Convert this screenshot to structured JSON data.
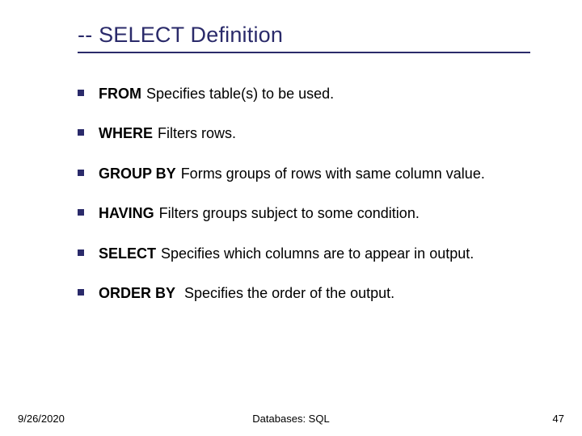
{
  "title": "-- SELECT Definition",
  "items": [
    {
      "keyword": "FROM",
      "desc": "Specifies table(s) to be used."
    },
    {
      "keyword": "WHERE",
      "desc": "Filters rows."
    },
    {
      "keyword": "GROUP BY",
      "desc": "Forms groups of rows with same column value."
    },
    {
      "keyword": "HAVING",
      "desc": "Filters groups subject to some condition."
    },
    {
      "keyword": "SELECT",
      "desc": "Specifies which columns are to appear in output."
    },
    {
      "keyword": "ORDER BY",
      "desc": " Specifies the order of the output."
    }
  ],
  "footer": {
    "date": "9/26/2020",
    "center": "Databases: SQL",
    "page": "47"
  },
  "colors": {
    "accent": "#2a2a6a",
    "text": "#000000",
    "background": "#ffffff"
  }
}
